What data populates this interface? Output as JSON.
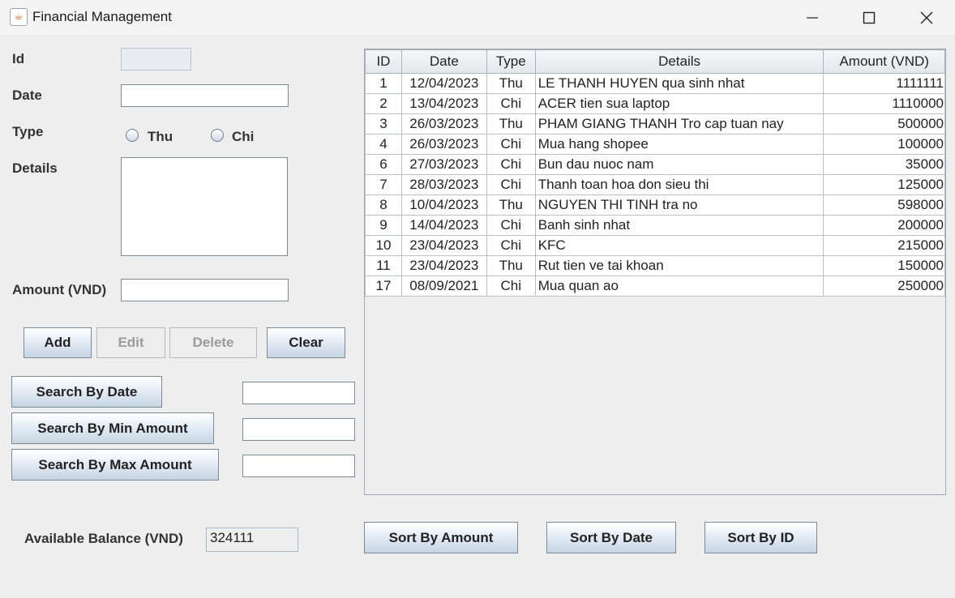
{
  "window": {
    "title": "Financial Management"
  },
  "form": {
    "id_label": "Id",
    "date_label": "Date",
    "type_label": "Type",
    "type_options": [
      "Thu",
      "Chi"
    ],
    "details_label": "Details",
    "amount_label": "Amount (VND)"
  },
  "buttons": {
    "add": "Add",
    "edit": "Edit",
    "delete": "Delete",
    "clear": "Clear",
    "search_date": "Search By Date",
    "search_min": "Search By Min Amount",
    "search_max": "Search By Max Amount",
    "sort_amount": "Sort By Amount",
    "sort_date": "Sort By Date",
    "sort_id": "Sort By ID"
  },
  "balance": {
    "label": "Available Balance (VND)",
    "value": "324111"
  },
  "table": {
    "columns": [
      "ID",
      "Date",
      "Type",
      "Details",
      "Amount (VND)"
    ],
    "rows": [
      [
        "1",
        "12/04/2023",
        "Thu",
        "LE THANH HUYEN qua sinh nhat",
        "1111111"
      ],
      [
        "2",
        "13/04/2023",
        "Chi",
        "ACER tien sua laptop",
        "1110000"
      ],
      [
        "3",
        "26/03/2023",
        "Thu",
        "PHAM GIANG THANH Tro cap tuan nay",
        "500000"
      ],
      [
        "4",
        "26/03/2023",
        "Chi",
        "Mua hang shopee",
        "100000"
      ],
      [
        "6",
        "27/03/2023",
        "Chi",
        "Bun dau nuoc nam",
        "35000"
      ],
      [
        "7",
        "28/03/2023",
        "Chi",
        "Thanh toan hoa don sieu thi",
        "125000"
      ],
      [
        "8",
        "10/04/2023",
        "Thu",
        "NGUYEN THI TINH tra no",
        "598000"
      ],
      [
        "9",
        "14/04/2023",
        "Chi",
        "Banh sinh nhat",
        "200000"
      ],
      [
        "10",
        "23/04/2023",
        "Chi",
        "KFC",
        "215000"
      ],
      [
        "11",
        "23/04/2023",
        "Thu",
        "Rut tien ve tai khoan",
        "150000"
      ],
      [
        "17",
        "08/09/2021",
        "Chi",
        "Mua quan ao",
        "250000"
      ]
    ]
  }
}
